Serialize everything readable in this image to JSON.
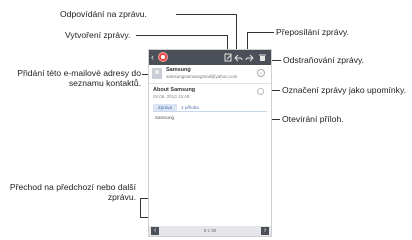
{
  "callouts": {
    "reply": "Odpovídání na zprávu.",
    "compose": "Vytvoření zprávy.",
    "forward": "Přeposílání zprávy.",
    "delete": "Odstraňování zprávy.",
    "add_contact": "Přidání této e-mailové adresy do seznamu kontaktů.",
    "reminder": "Označení zprávy jako upomínky.",
    "attachments": "Otevírání příloh.",
    "navigate": "Přechod na předchozí nebo další zprávu."
  },
  "email": {
    "sender_name": "Samsung",
    "sender_email": "samsungsamsungmail@yahoo.com",
    "subject": "About Samsung",
    "date": "04.06. 2013 15:48",
    "tab_content": "Zpráva",
    "tab_attachments": "1 příloha",
    "body": "Samsung"
  },
  "toolbar": {
    "back_icon": "‹",
    "icons": [
      "compose-icon",
      "reply-icon",
      "forward-icon",
      "delete-icon"
    ]
  },
  "footer": {
    "page_counter": "9 z 30",
    "prev": "‹",
    "next": "›"
  },
  "colors": {
    "toolbar": "#4b4f57",
    "app_icon": "#e94a4a",
    "tab_accent": "#4a6fa8"
  }
}
